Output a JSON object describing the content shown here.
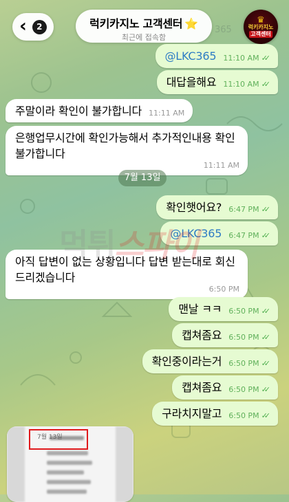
{
  "header": {
    "back_badge": "2",
    "title": "럭키카지노 고객센터",
    "title_star": "⭐",
    "status": "최근에 접속함",
    "avatar_line1": "럭키카지노",
    "avatar_line2": "고객센터",
    "ghost_number": "365"
  },
  "date_separator": "7월 13일",
  "watermark": {
    "part1": "먹튀",
    "part2": "스파이"
  },
  "messages": [
    {
      "dir": "out",
      "text": "@LKC365",
      "time": "11:10 AM"
    },
    {
      "dir": "out",
      "text": "대답을해요",
      "time": "11:10 AM"
    },
    {
      "dir": "in",
      "text": "주말이라 확인이 불가합니다",
      "time": "11:11 AM"
    },
    {
      "dir": "in",
      "text": "은행업무시간에 확인가능해서 추가적인내용 확인불가합니다",
      "time": "11:11 AM"
    },
    {
      "dir": "out",
      "text": "확인햇어요?",
      "time": "6:47 PM"
    },
    {
      "dir": "out",
      "text": "@LKC365",
      "time": "6:47 PM"
    },
    {
      "dir": "in",
      "text": "아직 답변이 없는 상황입니다 답변 받는대로 회신 드리겠습니다",
      "time": "6:50 PM"
    },
    {
      "dir": "out",
      "text": "맨날 ㅋㅋ",
      "time": "6:50 PM"
    },
    {
      "dir": "out",
      "text": "캡쳐좀요",
      "time": "6:50 PM"
    },
    {
      "dir": "out",
      "text": "확인중이라는거",
      "time": "6:50 PM"
    },
    {
      "dir": "out",
      "text": "캡쳐좀요",
      "time": "6:50 PM"
    },
    {
      "dir": "out",
      "text": "구라치지말고",
      "time": "6:50 PM"
    }
  ],
  "photo": {
    "caption": "7월 13일"
  },
  "colors": {
    "outgoing_bubble": "#e6fbd2",
    "incoming_bubble": "#ffffff",
    "link": "#2e7cc4",
    "check": "#4fae4e"
  }
}
